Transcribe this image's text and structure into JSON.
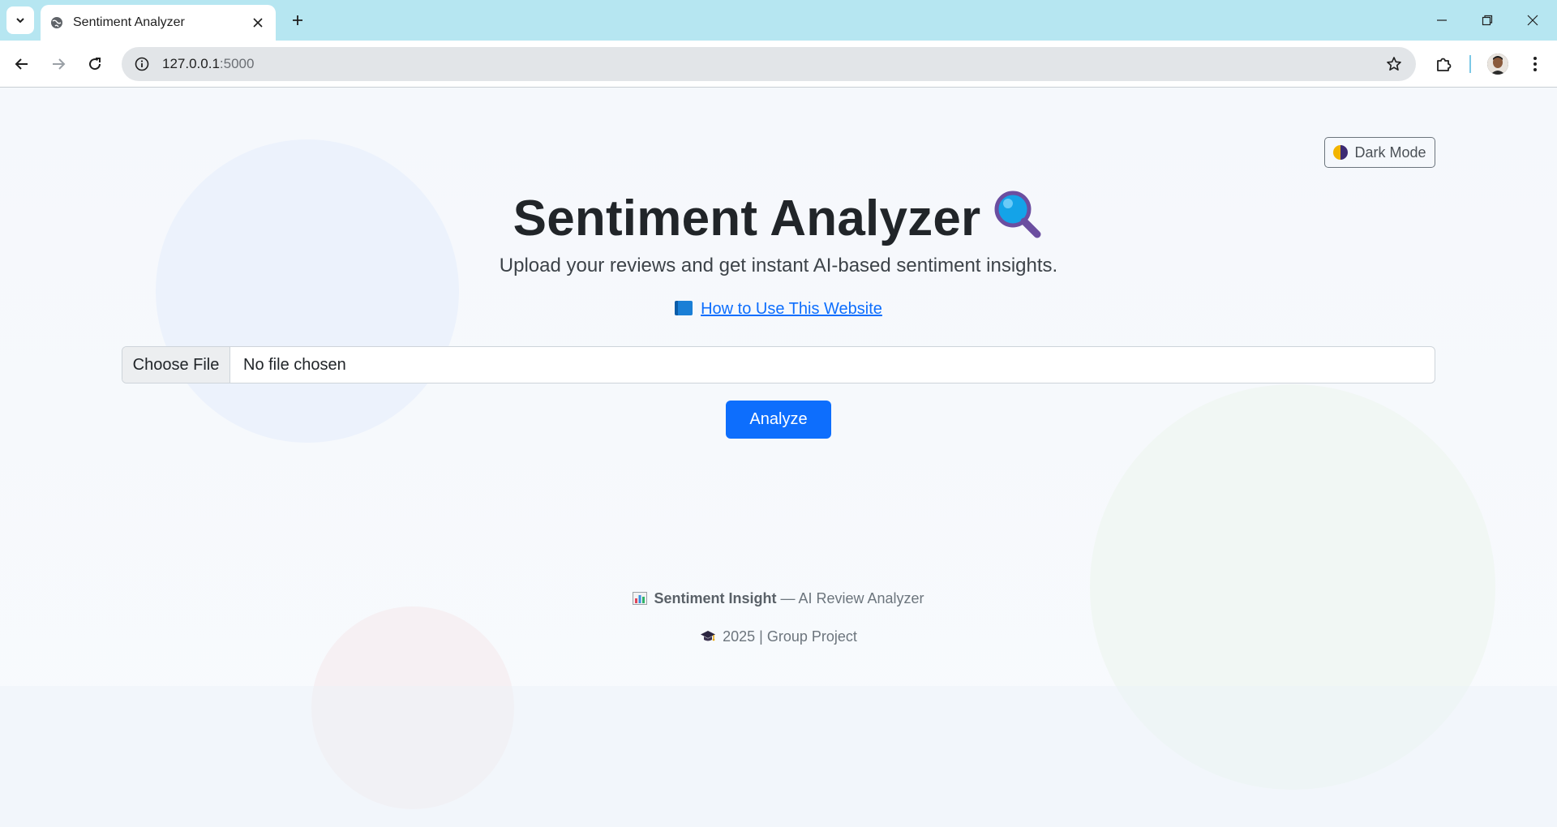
{
  "browser": {
    "tab_title": "Sentiment Analyzer",
    "url_host": "127.0.0.1",
    "url_port": ":5000"
  },
  "header": {
    "theme_toggle_label": "Dark Mode",
    "title": "Sentiment Analyzer",
    "subtitle": "Upload your reviews and get instant AI-based sentiment insights.",
    "help_link": "How to Use This Website"
  },
  "upload": {
    "choose_label": "Choose File",
    "file_status": "No file chosen",
    "analyze_label": "Analyze"
  },
  "footer": {
    "brand": "Sentiment Insight",
    "tagline": " — AI Review Analyzer",
    "credit": "2025 | Group Project"
  },
  "icons": {
    "title": "magnifier-icon",
    "help": "book-icon",
    "theme": "half-moon-icon",
    "brand": "bar-chart-icon",
    "credit": "graduation-cap-icon"
  },
  "colors": {
    "primary": "#0d6efd",
    "tabbar": "#b6e6f1"
  }
}
